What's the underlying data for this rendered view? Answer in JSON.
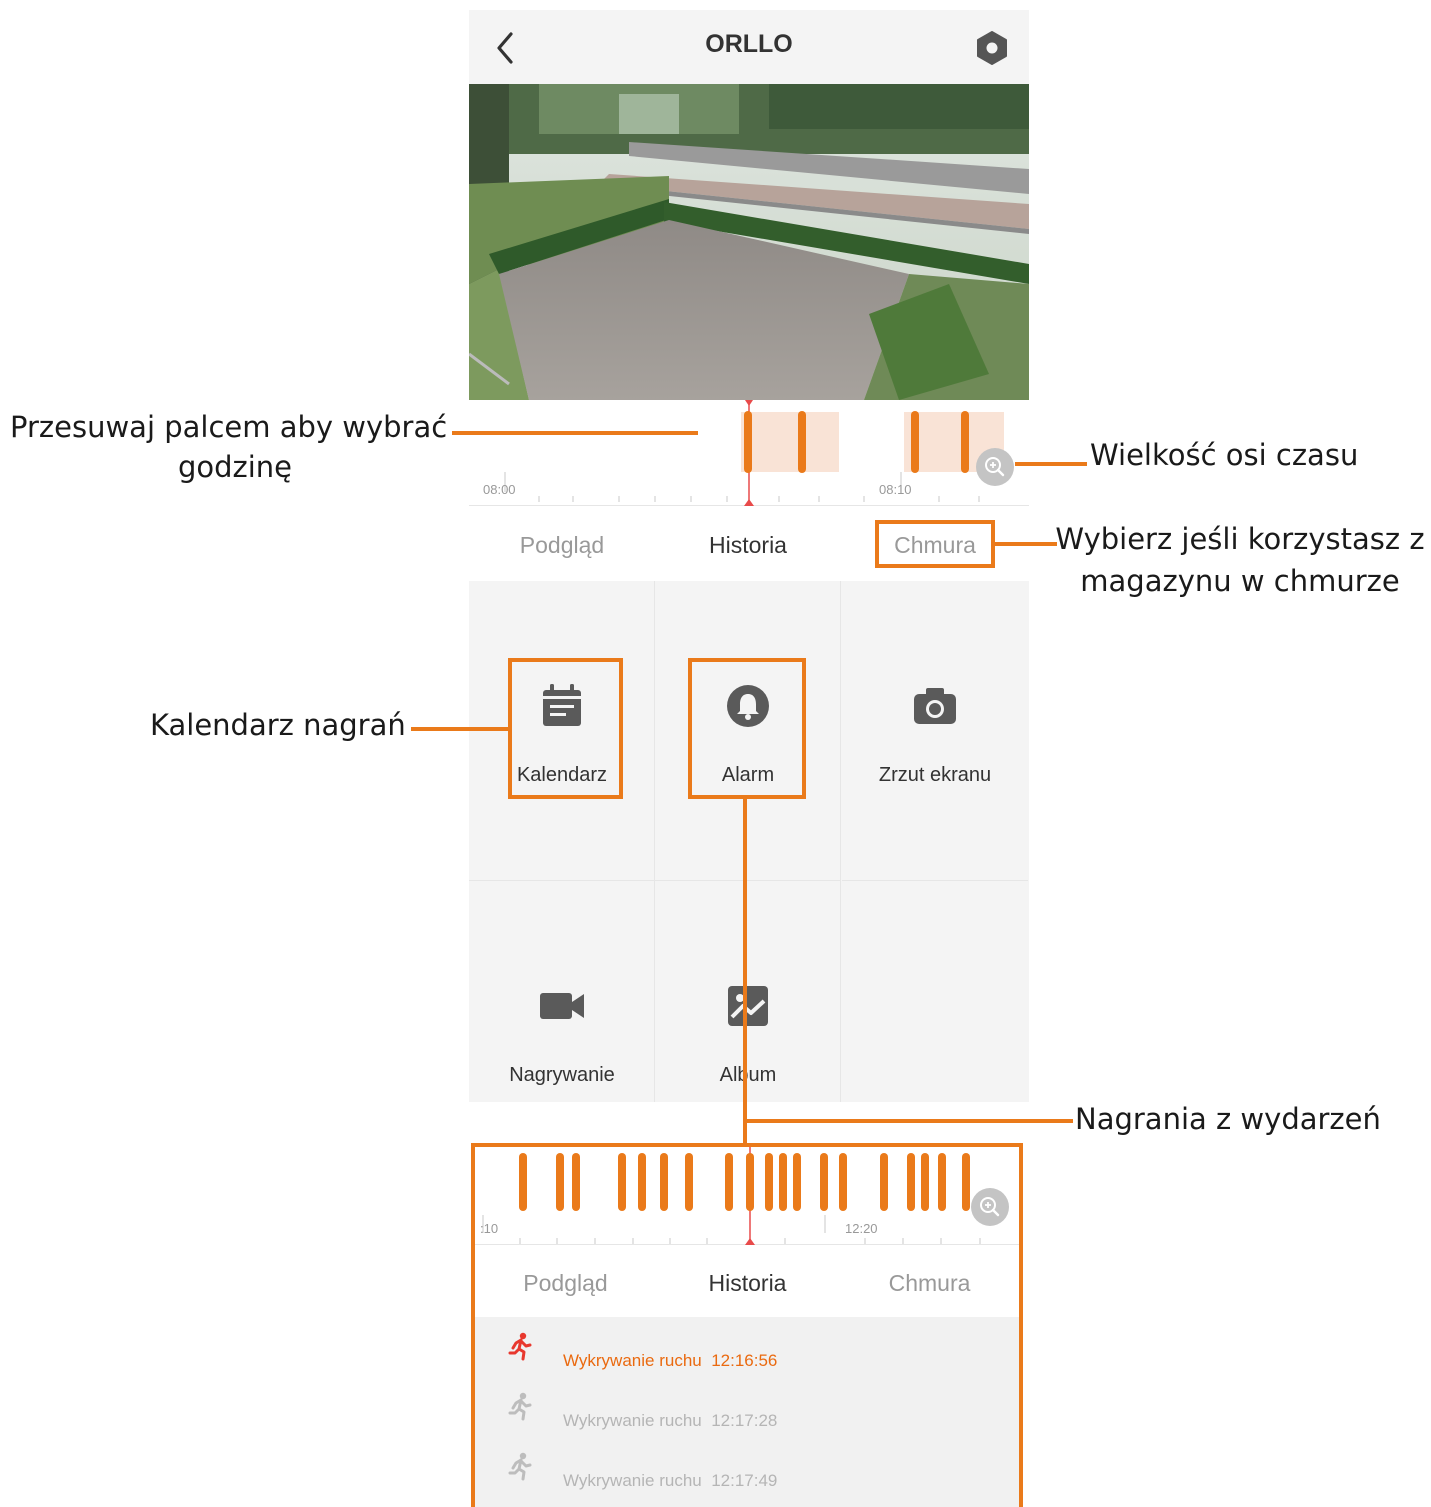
{
  "header": {
    "title": "ORLLO"
  },
  "timeline": {
    "tick_start": "08:00",
    "tick_end": "08:10"
  },
  "tabs": [
    {
      "label": "Podgląd",
      "state": "inactive"
    },
    {
      "label": "Historia",
      "state": "active"
    },
    {
      "label": "Chmura",
      "state": "inactive"
    }
  ],
  "grid": {
    "items": [
      {
        "label": "Kalendarz",
        "icon": "calendar-icon"
      },
      {
        "label": "Alarm",
        "icon": "bell-icon"
      },
      {
        "label": "Zrzut ekranu",
        "icon": "camera-icon"
      },
      {
        "label": "Nagrywanie",
        "icon": "video-icon"
      },
      {
        "label": "Album",
        "icon": "image-icon"
      }
    ]
  },
  "inset": {
    "tick_start": ":10",
    "tick_end": "12:20",
    "tabs": [
      {
        "label": "Podgląd",
        "state": "inactive"
      },
      {
        "label": "Historia",
        "state": "active"
      },
      {
        "label": "Chmura",
        "state": "inactive"
      }
    ],
    "events": [
      {
        "label": "Wykrywanie ruchu",
        "time": "12:16:56",
        "state": "active"
      },
      {
        "label": "Wykrywanie ruchu",
        "time": "12:17:28",
        "state": "inactive"
      },
      {
        "label": "Wykrywanie ruchu",
        "time": "12:17:49",
        "state": "inactive"
      }
    ]
  },
  "annotations": {
    "swipe_line1": "Przesuwaj palcem aby wybrać",
    "swipe_line2": "godzinę",
    "timeline_size": "Wielkość osi czasu",
    "cloud_line1": "Wybierz jeśli korzystasz z",
    "cloud_line2": "magazynu w chmurze",
    "calendar": "Kalendarz nagrań",
    "events": "Nagrania z wydarzeń"
  },
  "colors": {
    "accent": "#ea7a1a",
    "event_active": "#ea6a10",
    "icon_gray": "#5a5a5a",
    "background_gray": "#f4f4f4"
  }
}
